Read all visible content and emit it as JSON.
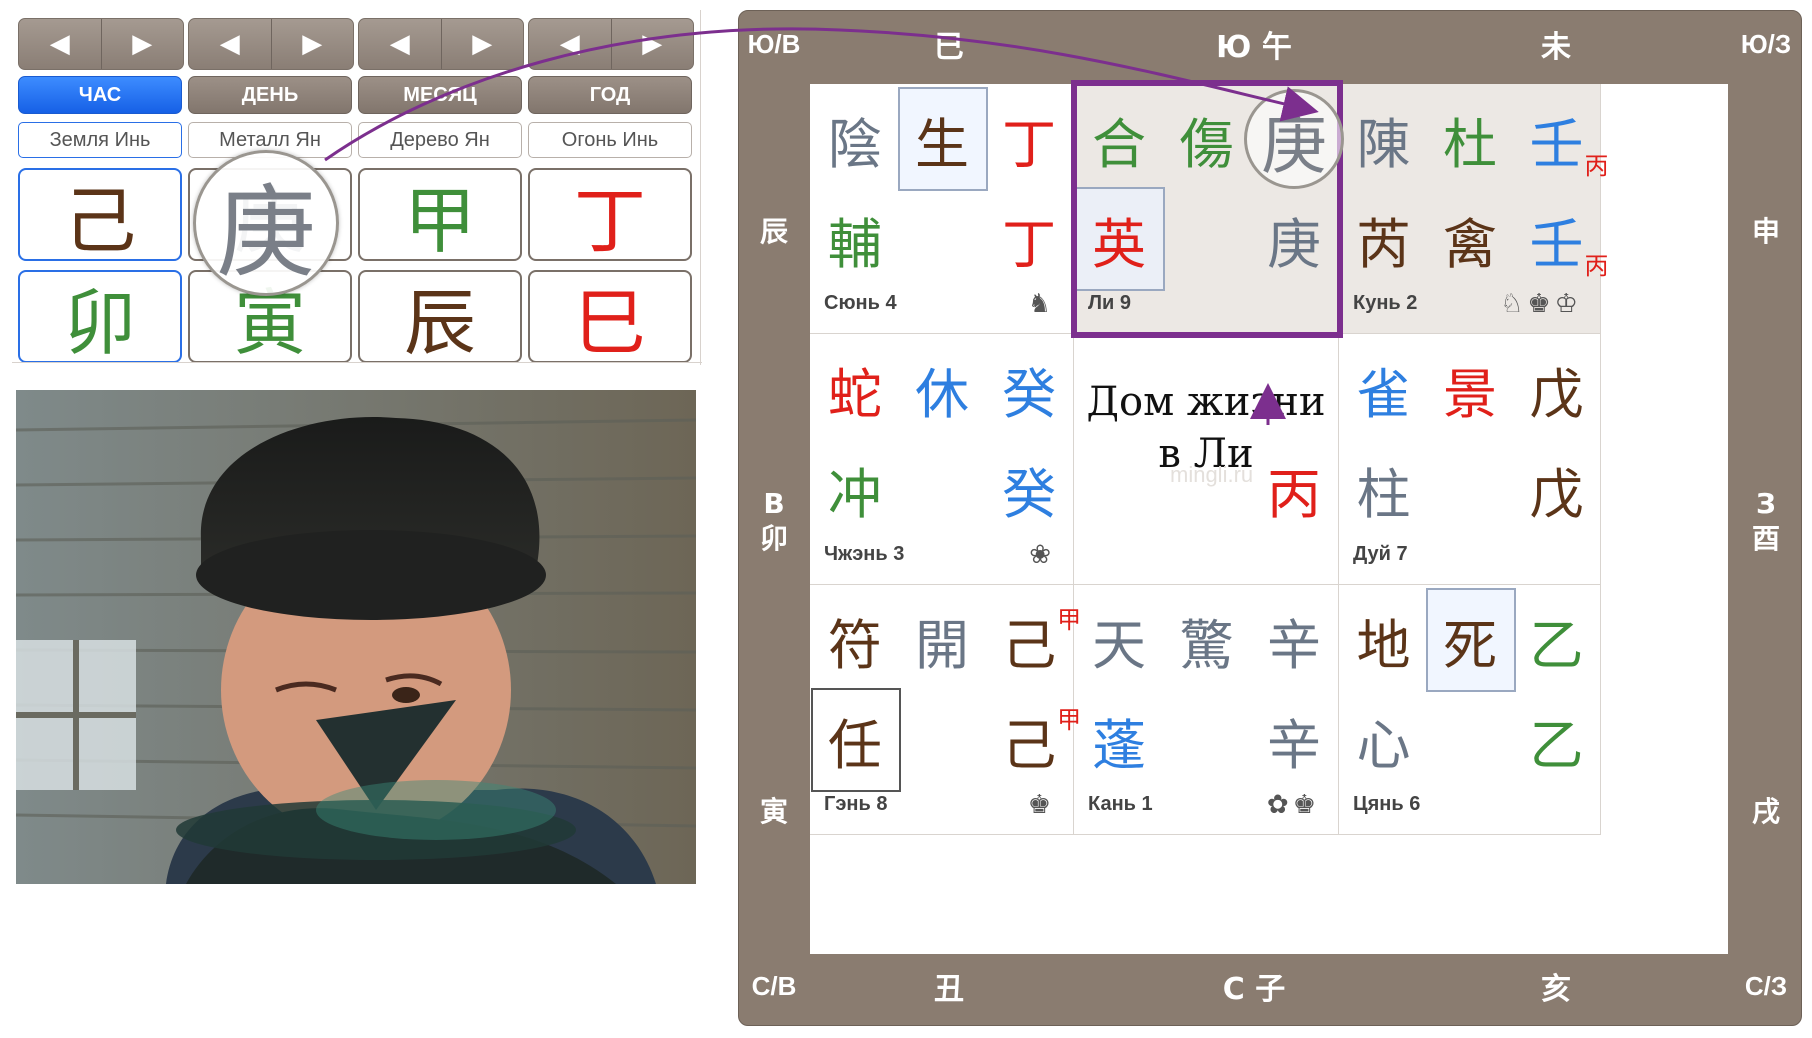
{
  "colors": {
    "green": "#3f8f3a",
    "red": "#e0201a",
    "blue": "#2e7fe0",
    "brown": "#5b3418",
    "gray": "#6a7686",
    "accent_blue": "#1660e6",
    "purple": "#7c2f8e",
    "board": "#8a7c70"
  },
  "nav": {
    "prev_symbol": "◀",
    "next_symbol": "▶"
  },
  "pillars": [
    {
      "tab": "ЧАС",
      "element": "Земля Инь",
      "stem": "己",
      "stem_color": "brown",
      "branch": "卯",
      "branch_color": "green",
      "active": true
    },
    {
      "tab": "ДЕНЬ",
      "element": "Металл Ян",
      "stem": "庚",
      "stem_color": "gray",
      "branch": "寅",
      "branch_color": "green",
      "active": false
    },
    {
      "tab": "МЕСЯЦ",
      "element": "Дерево Ян",
      "stem": "甲",
      "stem_color": "green",
      "branch": "辰",
      "branch_color": "brown",
      "active": false
    },
    {
      "tab": "ГОД",
      "element": "Огонь Инь",
      "stem": "丁",
      "stem_color": "red",
      "branch": "巳",
      "branch_color": "red",
      "active": false
    }
  ],
  "magnifier_char": "庚",
  "board": {
    "corners": {
      "top_left": "Ю/В",
      "top_right": "Ю/З",
      "bottom_left": "С/В",
      "bottom_right": "С/З"
    },
    "top": [
      "巳",
      "Ю 午",
      "未"
    ],
    "bottom": [
      "丑",
      "С 子",
      "亥"
    ],
    "left": [
      "辰",
      "В\n卯",
      "寅"
    ],
    "right": [
      "申",
      "З\n酉",
      "戌"
    ]
  },
  "palaces": [
    {
      "name": "Сюнь 4",
      "icons": "♞",
      "shade": false,
      "chars": [
        {
          "t": "陰",
          "c": "gray",
          "pos": "tl"
        },
        {
          "t": "生",
          "c": "brown",
          "pos": "tc",
          "box": true
        },
        {
          "t": "丁",
          "c": "red",
          "pos": "tr"
        },
        {
          "t": "輔",
          "c": "green",
          "pos": "ml"
        },
        {
          "t": "丁",
          "c": "red",
          "pos": "mr"
        }
      ]
    },
    {
      "name": "Ли 9",
      "icons": "",
      "shade": true,
      "chars": [
        {
          "t": "合",
          "c": "green",
          "pos": "tl"
        },
        {
          "t": "傷",
          "c": "green",
          "pos": "tc"
        },
        {
          "t": "英",
          "c": "red",
          "pos": "ml",
          "box": true
        },
        {
          "t": "庚",
          "c": "gray",
          "pos": "mr"
        }
      ]
    },
    {
      "name": "Кунь 2",
      "icons": "♘♚♔",
      "shade": true,
      "chars": [
        {
          "t": "陳",
          "c": "gray",
          "pos": "tl"
        },
        {
          "t": "杜",
          "c": "green",
          "pos": "tc"
        },
        {
          "t": "壬",
          "c": "blue",
          "pos": "tr",
          "sub": "丙"
        },
        {
          "t": "芮",
          "c": "brown",
          "pos": "ml"
        },
        {
          "t": "禽",
          "c": "brown",
          "pos": "mc"
        },
        {
          "t": "壬",
          "c": "blue",
          "pos": "mr",
          "sub": "丙"
        }
      ]
    },
    {
      "name": "Чжэнь 3",
      "icons": "❀",
      "shade": false,
      "chars": [
        {
          "t": "蛇",
          "c": "red",
          "pos": "tl"
        },
        {
          "t": "休",
          "c": "blue",
          "pos": "tc"
        },
        {
          "t": "癸",
          "c": "blue",
          "pos": "tr"
        },
        {
          "t": "冲",
          "c": "green",
          "pos": "ml"
        },
        {
          "t": "癸",
          "c": "blue",
          "pos": "mr"
        }
      ]
    },
    {
      "name": "",
      "icons": "",
      "shade": false,
      "chars": [
        {
          "t": "丙",
          "c": "red",
          "pos": "mr"
        }
      ]
    },
    {
      "name": "Дуй 7",
      "icons": "",
      "shade": false,
      "chars": [
        {
          "t": "雀",
          "c": "blue",
          "pos": "tl"
        },
        {
          "t": "景",
          "c": "red",
          "pos": "tc"
        },
        {
          "t": "戊",
          "c": "brown",
          "pos": "tr"
        },
        {
          "t": "柱",
          "c": "gray",
          "pos": "ml"
        },
        {
          "t": "戊",
          "c": "brown",
          "pos": "mr"
        }
      ]
    },
    {
      "name": "Гэнь 8",
      "icons": "♚",
      "shade": false,
      "chars": [
        {
          "t": "符",
          "c": "brown",
          "pos": "tl"
        },
        {
          "t": "開",
          "c": "gray",
          "pos": "tc"
        },
        {
          "t": "己",
          "c": "brown",
          "pos": "tr",
          "sup": "甲"
        },
        {
          "t": "任",
          "c": "brown",
          "pos": "ml",
          "box": "dark"
        },
        {
          "t": "己",
          "c": "brown",
          "pos": "mr",
          "sup": "甲"
        }
      ]
    },
    {
      "name": "Кань 1",
      "icons": "✿♚",
      "shade": false,
      "chars": [
        {
          "t": "天",
          "c": "gray",
          "pos": "tl"
        },
        {
          "t": "驚",
          "c": "gray",
          "pos": "tc"
        },
        {
          "t": "辛",
          "c": "gray",
          "pos": "tr"
        },
        {
          "t": "蓬",
          "c": "blue",
          "pos": "ml"
        },
        {
          "t": "辛",
          "c": "gray",
          "pos": "mr"
        }
      ]
    },
    {
      "name": "Цянь 6",
      "icons": "",
      "shade": false,
      "chars": [
        {
          "t": "地",
          "c": "brown",
          "pos": "tl"
        },
        {
          "t": "死",
          "c": "brown",
          "pos": "tc",
          "box": true
        },
        {
          "t": "乙",
          "c": "green",
          "pos": "tr"
        },
        {
          "t": "心",
          "c": "gray",
          "pos": "ml"
        },
        {
          "t": "乙",
          "c": "green",
          "pos": "mr"
        }
      ]
    }
  ],
  "li_circle_char": "庚",
  "annotation": {
    "line1": "Дом жизни",
    "line2": "в Ли"
  },
  "watermark": "mingli.ru"
}
